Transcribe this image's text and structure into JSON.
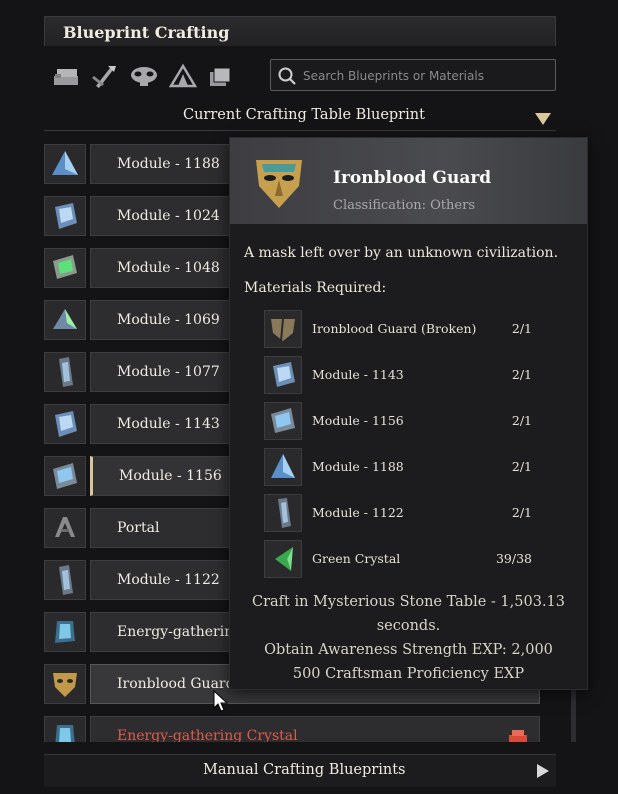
{
  "title": "Blueprint Crafting",
  "toolbar": {
    "icons": [
      "items-stack-icon",
      "tools-icon",
      "mask-icon",
      "tent-icon",
      "pages-icon"
    ]
  },
  "search": {
    "placeholder": "Search Blueprints or Materials"
  },
  "section": {
    "label": "Current Crafting Table Blueprint"
  },
  "list": {
    "rows": [
      {
        "label": "Module - 1188",
        "icon": "blue-pyramid-module-icon"
      },
      {
        "label": "Module - 1024",
        "icon": "blue-cube-module-icon"
      },
      {
        "label": "Module - 1048",
        "icon": "green-chip-module-icon"
      },
      {
        "label": "Module - 1069",
        "icon": "green-pyramid-module-icon"
      },
      {
        "label": "Module - 1077",
        "icon": "slab-module-icon"
      },
      {
        "label": "Module - 1143",
        "icon": "blue-cube-module-icon"
      },
      {
        "label": "Module - 1156",
        "icon": "blue-chip-module-icon",
        "selected": true
      },
      {
        "label": "Portal",
        "icon": "portal-icon"
      },
      {
        "label": "Module - 1122",
        "icon": "slab-module-icon"
      },
      {
        "label": "Energy-gathering",
        "icon": "energy-crystal-icon"
      },
      {
        "label": "Ironblood Guard",
        "icon": "golden-mask-icon",
        "hovered": true
      },
      {
        "label": "Energy-gathering Crystal",
        "icon": "energy-crystal-icon",
        "warning": true
      }
    ]
  },
  "bottom": {
    "label": "Manual Crafting Blueprints"
  },
  "tooltip": {
    "name": "Ironblood Guard",
    "classification": "Classification: Others",
    "description": "A mask left over by an unknown civilization.",
    "materials_label": "Materials Required:",
    "materials": [
      {
        "name": "Ironblood Guard (Broken)",
        "qty": "2/1",
        "icon": "broken-mask-icon"
      },
      {
        "name": "Module - 1143",
        "qty": "2/1",
        "icon": "blue-cube-module-icon"
      },
      {
        "name": "Module - 1156",
        "qty": "2/1",
        "icon": "blue-chip-module-icon"
      },
      {
        "name": "Module - 1188",
        "qty": "2/1",
        "icon": "blue-pyramid-module-icon"
      },
      {
        "name": "Module - 1122",
        "qty": "2/1",
        "icon": "slab-module-icon"
      },
      {
        "name": "Green Crystal",
        "qty": "39/38",
        "icon": "green-crystal-icon"
      }
    ],
    "craft_line1": "Craft in Mysterious Stone Table - 1,503.13",
    "craft_line2": "seconds.",
    "exp_line1": "Obtain Awareness Strength EXP: 2,000",
    "exp_line2": "500 Craftsman Proficiency EXP"
  }
}
